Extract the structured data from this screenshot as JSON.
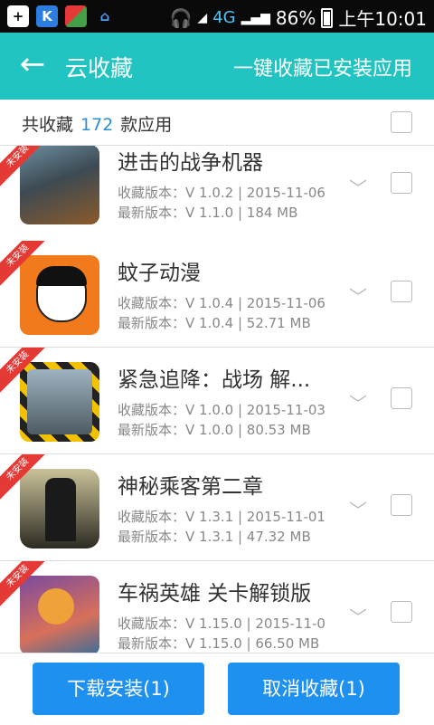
{
  "status_bar": {
    "network": "4G",
    "battery": "86%",
    "time": "上午10:01"
  },
  "header": {
    "title": "云收藏",
    "action": "一键收藏已安装应用"
  },
  "summary": {
    "prefix": "共收藏",
    "count": "172",
    "suffix": "款应用"
  },
  "apps": [
    {
      "name": "进击的战争机器",
      "collected": "收藏版本：V 1.0.2 | 2015-11-06",
      "latest": "最新版本：V 1.1.0 | 184 MB",
      "badge": "未安装"
    },
    {
      "name": "蚊子动漫",
      "collected": "收藏版本：V 1.0.4 | 2015-11-06",
      "latest": "最新版本：V 1.0.4 | 52.71 MB",
      "badge": "未安装"
    },
    {
      "name": "紧急追降：战场 解...",
      "collected": "收藏版本：V 1.0.0 | 2015-11-03",
      "latest": "最新版本：V 1.0.0 | 80.53 MB",
      "badge": "未安装"
    },
    {
      "name": "神秘乘客第二章",
      "collected": "收藏版本：V 1.3.1 | 2015-11-01",
      "latest": "最新版本：V 1.3.1 | 47.32 MB",
      "badge": "未安装"
    },
    {
      "name": "车祸英雄 关卡解锁版",
      "collected": "收藏版本：V 1.15.0 | 2015-11-0",
      "latest": "最新版本：V 1.15.0 | 66.50 MB",
      "badge": "未安装"
    }
  ],
  "buttons": {
    "install": "下载安装(1)",
    "cancel": "取消收藏(1)"
  },
  "colors": {
    "accent": "#21c4c0",
    "button": "#1e90f0",
    "badge": "#e53935"
  }
}
